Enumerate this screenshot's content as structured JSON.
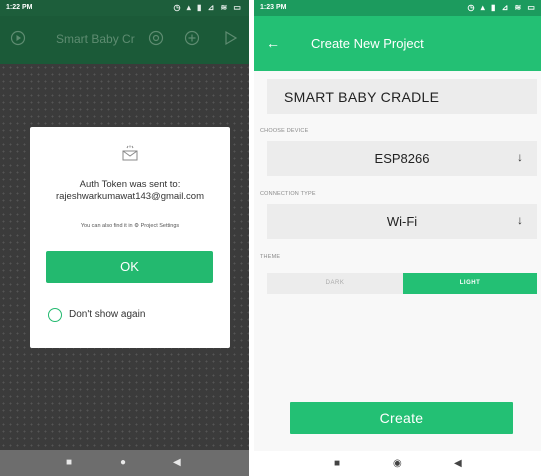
{
  "left_screen": {
    "status_time": "1:22 PM",
    "status_icons": "◷ ▴ ▮ ⊿ ≋ ▭",
    "app_title": "Smart Baby Cr",
    "dialog": {
      "line1": "Auth Token was sent to:",
      "line2": "rajeshwarkumawat143@gmail.com",
      "hint": "You can also find it in ⚙ Project Settings",
      "ok_label": "OK",
      "dont_show_label": "Don't show again"
    },
    "nav": {
      "square": "■",
      "home": "●",
      "back": "◀"
    }
  },
  "right_screen": {
    "status_time": "1:23 PM",
    "status_icons": "◷ ▴ ▮ ⊿ ≋ ▭",
    "back_glyph": "←",
    "title": "Create New Project",
    "project_name": "SMART BABY CRADLE",
    "choose_device_label": "CHOOSE DEVICE",
    "device_value": "ESP8266",
    "connection_type_label": "CONNECTION TYPE",
    "connection_value": "Wi-Fi",
    "theme_label": "THEME",
    "theme_dark": "DARK",
    "theme_light": "LIGHT",
    "theme_selected": "LIGHT",
    "create_label": "Create",
    "dropdown_arrow": "↓",
    "nav": {
      "square": "■",
      "home": "◉",
      "back": "◀"
    }
  },
  "colors": {
    "accent_green": "#23c074",
    "dark_appbar": "#1b5a38"
  }
}
